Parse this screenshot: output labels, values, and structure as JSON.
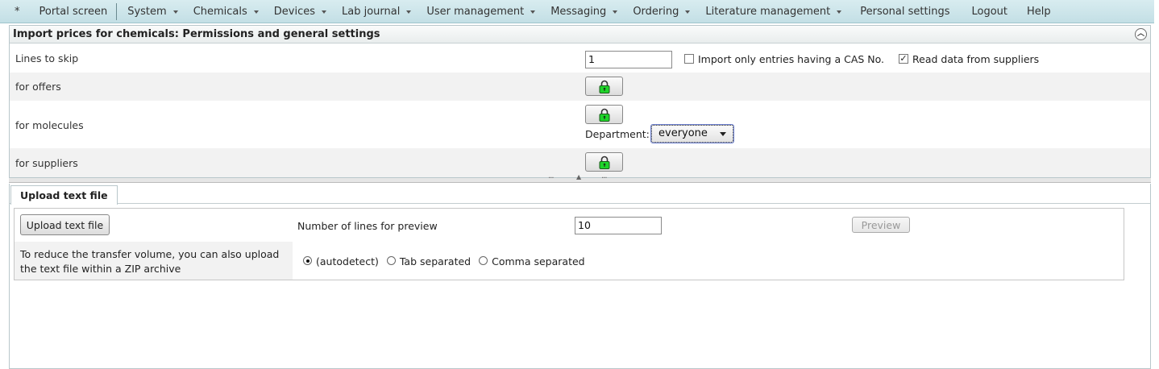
{
  "menu": {
    "star": "*",
    "portal": "Portal screen",
    "items": [
      {
        "label": "System"
      },
      {
        "label": "Chemicals"
      },
      {
        "label": "Devices"
      },
      {
        "label": "Lab journal"
      },
      {
        "label": "User management"
      },
      {
        "label": "Messaging"
      },
      {
        "label": "Ordering"
      },
      {
        "label": "Literature management"
      }
    ],
    "personal": "Personal settings",
    "logout": "Logout",
    "help": "Help"
  },
  "settings_panel": {
    "title": "Import prices for chemicals: Permissions and general settings",
    "lines_to_skip_label": "Lines to skip",
    "lines_to_skip_value": "1",
    "cas_only_label": "Import only entries having a CAS No.",
    "cas_only_checked": false,
    "read_suppliers_label": "Read data from suppliers",
    "read_suppliers_checked": true,
    "offers_label": "for offers",
    "molecules_label": "for molecules",
    "department_label": "Department:",
    "department_value": "everyone",
    "suppliers_label": "for suppliers",
    "lock_icon": "lock-icon",
    "lock_color": "#1fd42a"
  },
  "upload_panel": {
    "tab_label": "Upload text file",
    "upload_button": "Upload text file",
    "preview_lines_label": "Number of lines for preview",
    "preview_lines_value": "10",
    "preview_button": "Preview",
    "zip_hint": "To reduce the transfer volume, you can also upload the text file within a ZIP archive",
    "separator_options": [
      {
        "label": "(autodetect)",
        "selected": true
      },
      {
        "label": "Tab separated",
        "selected": false
      },
      {
        "label": "Comma separated",
        "selected": false
      }
    ]
  }
}
